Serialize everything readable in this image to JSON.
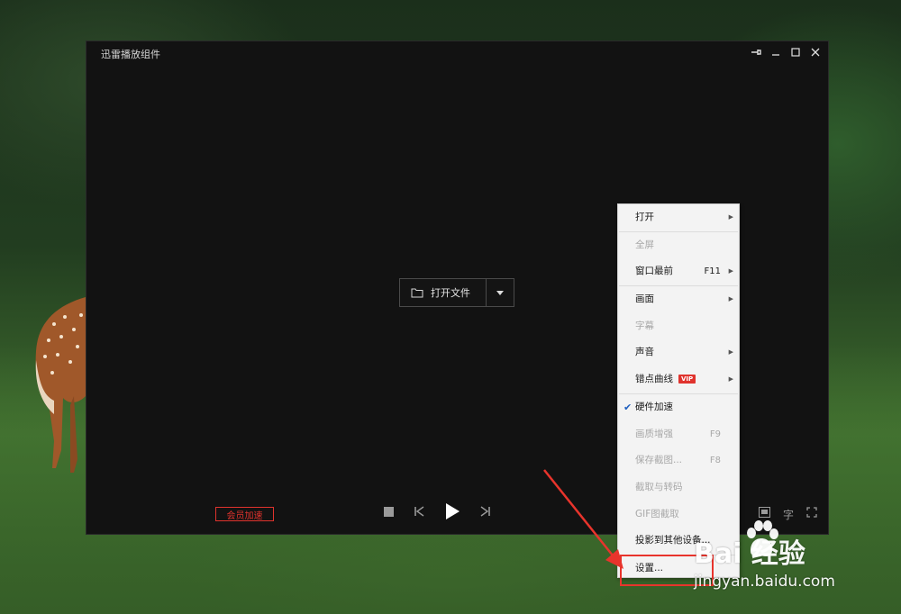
{
  "window": {
    "title": "迅雷播放组件",
    "pin_icon": "pin-icon",
    "minimize_icon": "minimize-icon",
    "maximize_icon": "maximize-icon",
    "close_icon": "close-icon"
  },
  "center": {
    "open_file_label": "打开文件",
    "folder_icon": "folder-icon",
    "dropdown_icon": "caret-down-icon"
  },
  "bottom_bar": {
    "vip_speed_label": "会员加速",
    "subtitle_glyph": "字"
  },
  "context_menu": {
    "items": [
      {
        "label": "打开",
        "submenu": true,
        "enabled": true
      },
      {
        "label": "全屏",
        "enabled": false
      },
      {
        "label": "窗口最前",
        "shortcut": "F11",
        "submenu": true,
        "enabled": true
      },
      {
        "label": "画面",
        "submenu": true,
        "enabled": true
      },
      {
        "label": "字幕",
        "enabled": false
      },
      {
        "label": "声音",
        "submenu": true,
        "enabled": true
      },
      {
        "label": "错点曲线",
        "badge": "VIP",
        "submenu": true,
        "enabled": true
      },
      {
        "label": "硬件加速",
        "checked": true,
        "enabled": true
      },
      {
        "label": "画质增强",
        "shortcut": "F9",
        "enabled": false
      },
      {
        "label": "保存截图...",
        "shortcut": "F8",
        "enabled": false
      },
      {
        "label": "截取与转码",
        "enabled": false
      },
      {
        "label": "GIF图截取",
        "enabled": false
      },
      {
        "label": "投影到其他设备...",
        "enabled": true
      },
      {
        "label": "设置...",
        "enabled": true,
        "highlighted": true
      }
    ]
  },
  "watermark": {
    "brand": "Bai  经验",
    "site": "jingyan.baidu.com"
  },
  "colors": {
    "accent_red": "#e0332d",
    "check_blue": "#1f5fbf",
    "player_bg": "#121212"
  }
}
